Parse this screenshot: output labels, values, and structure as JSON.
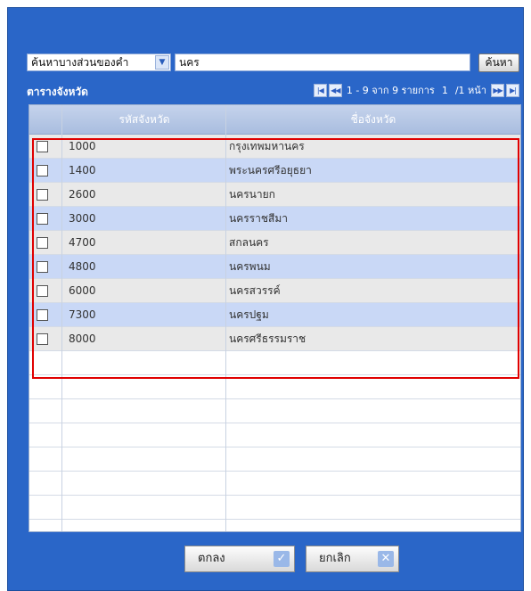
{
  "search": {
    "mode_selected": "ค้นหาบางส่วนของคำ",
    "query_value": "นคร",
    "search_button": "ค้นหา"
  },
  "table": {
    "title": "ตารางจังหวัด",
    "pager_text": "1 - 9 จาก 9 รายการ",
    "page_current": "1",
    "page_total": "/1 หน้า",
    "col_code": "รหัสจังหวัด",
    "col_name": "ชื่อจังหวัด",
    "rows": [
      {
        "code": "1000",
        "name": "กรุงเทพมหานคร"
      },
      {
        "code": "1400",
        "name": "พระนครศรีอยุธยา"
      },
      {
        "code": "2600",
        "name": "นครนายก"
      },
      {
        "code": "3000",
        "name": "นครราชสีมา"
      },
      {
        "code": "4700",
        "name": "สกลนคร"
      },
      {
        "code": "4800",
        "name": "นครพนม"
      },
      {
        "code": "6000",
        "name": "นครสวรรค์"
      },
      {
        "code": "7300",
        "name": "นครปฐม"
      },
      {
        "code": "8000",
        "name": "นครศรีธรรมราช"
      }
    ]
  },
  "footer": {
    "ok_label": "ตกลง",
    "cancel_label": "ยกเลิก"
  },
  "icons": {
    "dropdown": "chevron-down-icon",
    "first": "first-page-icon",
    "prev": "prev-page-icon",
    "next": "next-page-icon",
    "last": "last-page-icon",
    "ok": "check-icon",
    "cancel": "close-icon"
  }
}
